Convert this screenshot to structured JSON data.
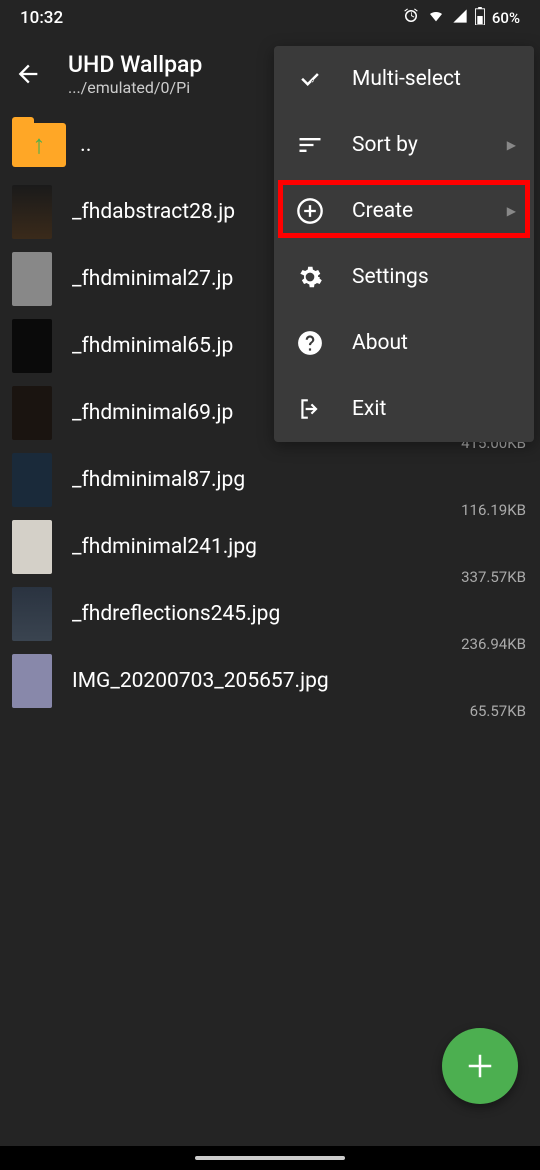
{
  "status": {
    "time": "10:32",
    "battery": "60%"
  },
  "header": {
    "title": "UHD Wallpap",
    "path": ".../emulated/0/Pi"
  },
  "parent": {
    "label": ".."
  },
  "files": [
    {
      "name": "_fhdabstract28.jp",
      "size": "",
      "thumb": "t1"
    },
    {
      "name": "_fhdminimal27.jp",
      "size": "",
      "thumb": "t2"
    },
    {
      "name": "_fhdminimal65.jp",
      "size": "",
      "thumb": "t3"
    },
    {
      "name": "_fhdminimal69.jp",
      "size": "415.00KB",
      "thumb": "t4"
    },
    {
      "name": "_fhdminimal87.jpg",
      "size": "116.19KB",
      "thumb": "t5"
    },
    {
      "name": "_fhdminimal241.jpg",
      "size": "337.57KB",
      "thumb": "t6"
    },
    {
      "name": "_fhdreflections245.jpg",
      "size": "236.94KB",
      "thumb": "t7"
    },
    {
      "name": "IMG_20200703_205657.jpg",
      "size": "65.57KB",
      "thumb": "t8"
    }
  ],
  "menu": {
    "items": [
      {
        "label": "Multi-select",
        "icon": "check-all-icon",
        "chevron": false
      },
      {
        "label": "Sort by",
        "icon": "sort-icon",
        "chevron": true
      },
      {
        "label": "Create",
        "icon": "plus-circle-icon",
        "chevron": true,
        "highlighted": true
      },
      {
        "label": "Settings",
        "icon": "gear-icon",
        "chevron": false
      },
      {
        "label": "About",
        "icon": "help-icon",
        "chevron": false
      },
      {
        "label": "Exit",
        "icon": "exit-icon",
        "chevron": false
      }
    ]
  }
}
